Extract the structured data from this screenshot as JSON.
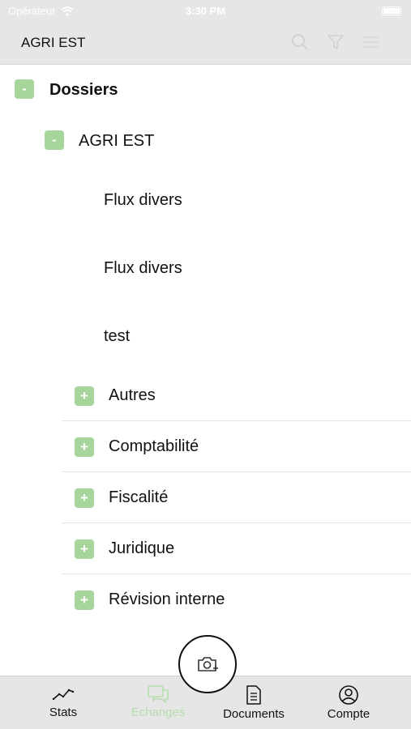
{
  "status_bar": {
    "carrier": "Opérateur",
    "time": "3:30 PM"
  },
  "header": {
    "title": "AGRI EST",
    "icons": [
      "search-icon",
      "filter-icon",
      "menu-icon"
    ]
  },
  "tree": {
    "root": {
      "toggle": "-",
      "label": "Dossiers"
    },
    "client": {
      "toggle": "-",
      "label": "AGRI EST"
    },
    "files": [
      "Flux divers",
      "Flux divers",
      "test"
    ],
    "categories": [
      {
        "toggle": "+",
        "label": "Autres"
      },
      {
        "toggle": "+",
        "label": "Comptabilité"
      },
      {
        "toggle": "+",
        "label": "Fiscalité"
      },
      {
        "toggle": "+",
        "label": "Juridique"
      },
      {
        "toggle": "+",
        "label": "Révision interne"
      }
    ]
  },
  "fab": {
    "icon": "camera-add-icon"
  },
  "tabbar": {
    "tabs": [
      {
        "label": "Stats",
        "icon": "stats-line-icon",
        "active": false
      },
      {
        "label": "Echanges",
        "icon": "chat-bubbles-icon",
        "active": true
      },
      {
        "label": "Documents",
        "icon": "document-icon",
        "active": false
      },
      {
        "label": "Compte",
        "icon": "account-icon",
        "active": false
      }
    ]
  },
  "colors": {
    "accent_green": "#a6d59c",
    "active_tab": "#b7ddb0",
    "header_bg": "#e6e6e6"
  }
}
